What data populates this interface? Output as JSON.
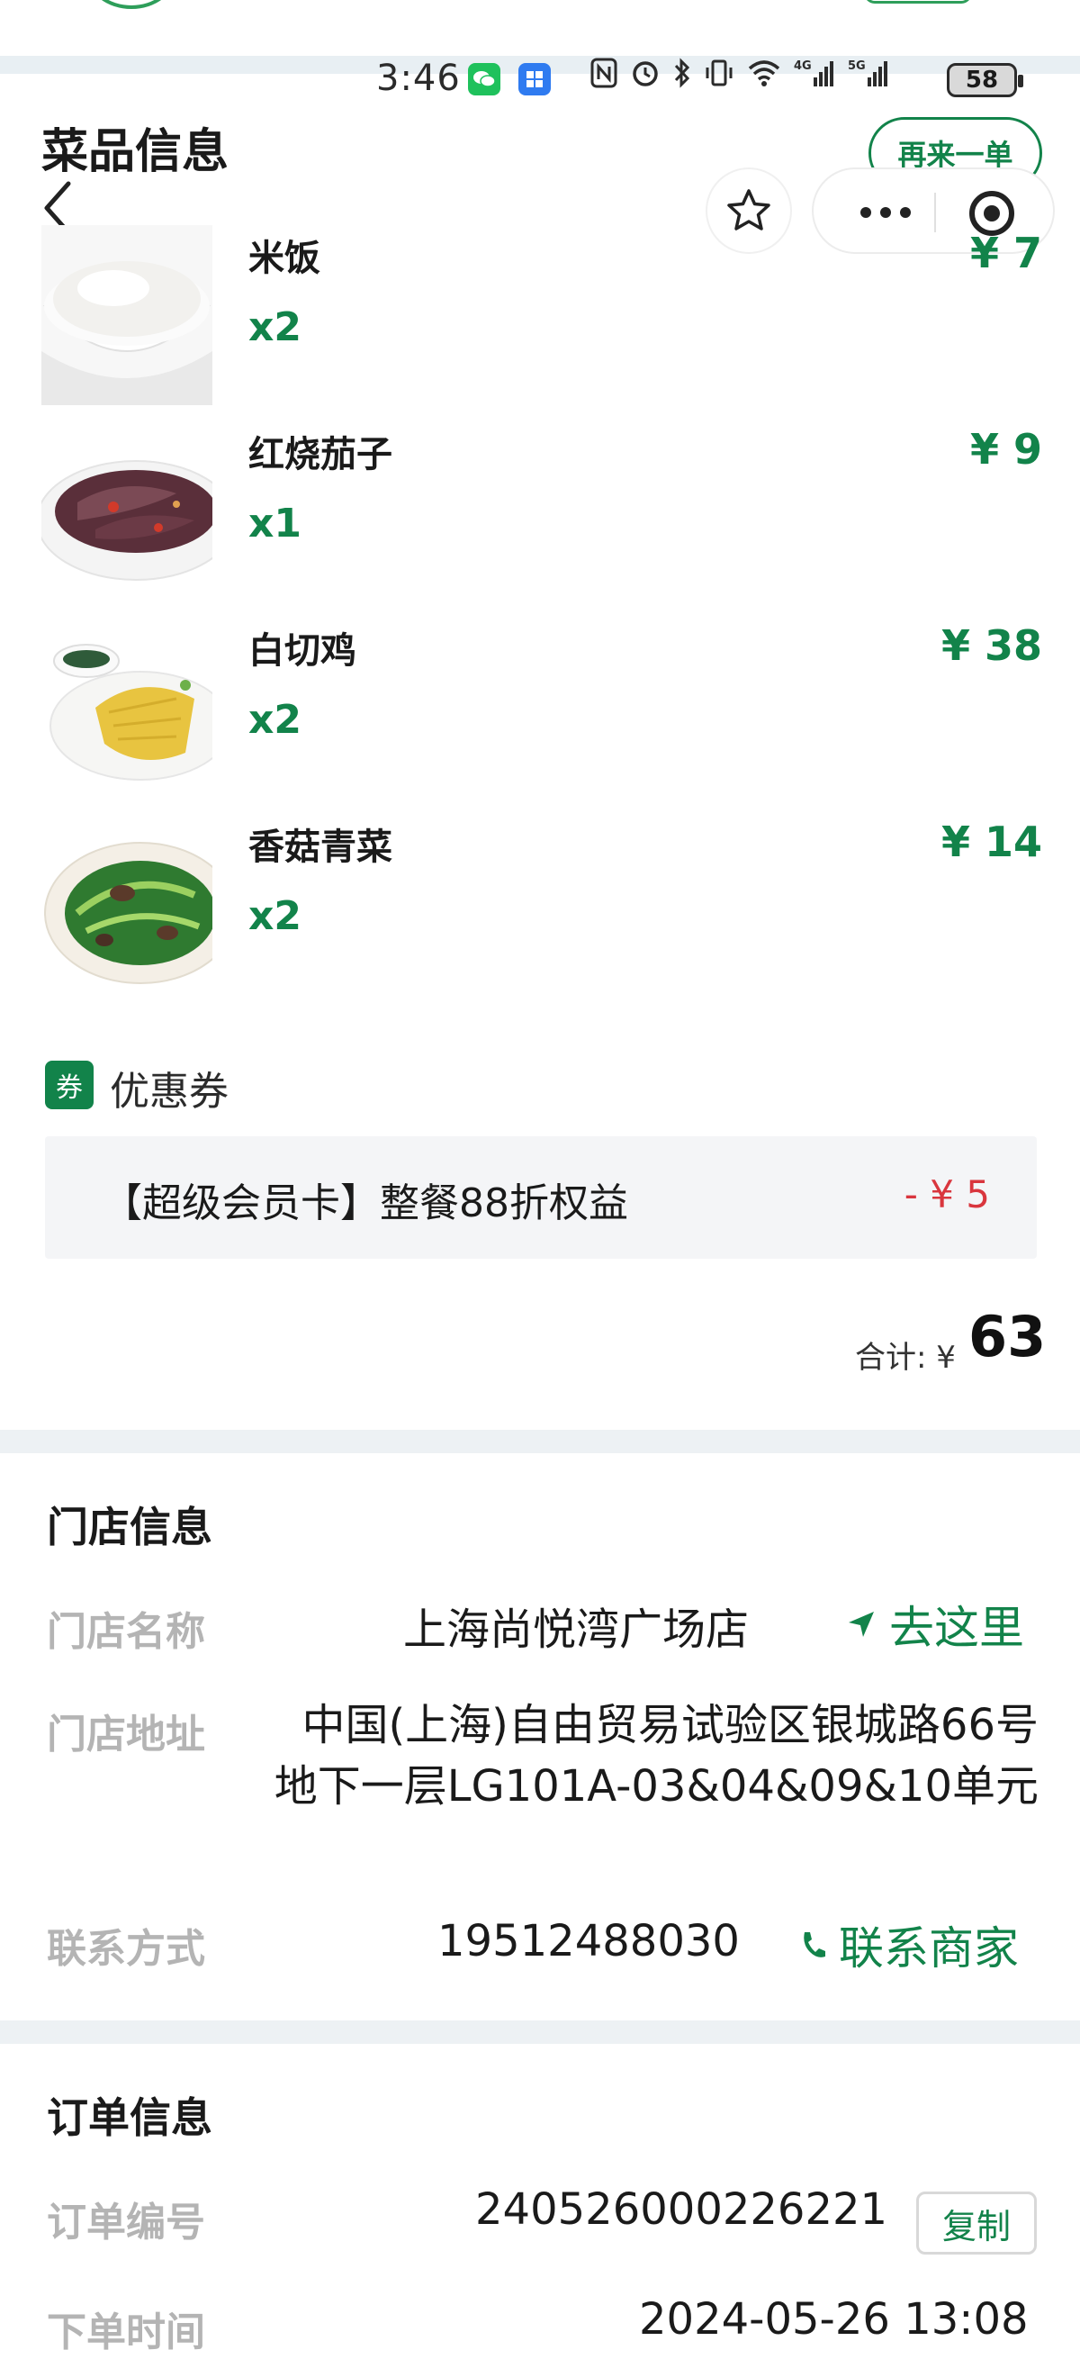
{
  "status_bar": {
    "time": "3:46",
    "battery": "58",
    "network_labels": [
      "4G",
      "5G"
    ]
  },
  "header": {
    "section_title": "菜品信息",
    "reorder_label": "再来一单"
  },
  "dishes": [
    {
      "name": "米饭",
      "qty": "x2",
      "price": "¥ 7"
    },
    {
      "name": "红烧茄子",
      "qty": "x1",
      "price": "¥ 9"
    },
    {
      "name": "白切鸡",
      "qty": "x2",
      "price": "¥ 38"
    },
    {
      "name": "香菇青菜",
      "qty": "x2",
      "price": "¥ 14"
    }
  ],
  "coupon": {
    "icon_text": "券",
    "title": "优惠券",
    "description": "【超级会员卡】整餐88折权益",
    "amount": "- ¥ 5"
  },
  "total": {
    "label": "合计: ¥",
    "value": "63"
  },
  "store_info": {
    "title": "门店信息",
    "name_label": "门店名称",
    "name_value": "上海尚悦湾广场店",
    "navigate_label": "去这里",
    "address_label": "门店地址",
    "address_value": "中国(上海)自由贸易试验区银城路66号地下一层LG101A-03&04&09&10单元",
    "contact_label": "联系方式",
    "contact_value": "19512488030",
    "contact_action": "联系商家"
  },
  "order_info": {
    "title": "订单信息",
    "number_label": "订单编号",
    "number_value": "240526000226221",
    "copy_label": "复制",
    "time_label": "下单时间",
    "time_value": "2024-05-26 13:08"
  },
  "colors": {
    "accent_green": "#12834a",
    "discount_red": "#d9363e",
    "label_gray": "#b4b4b4",
    "section_gap": "#edf1f4"
  }
}
